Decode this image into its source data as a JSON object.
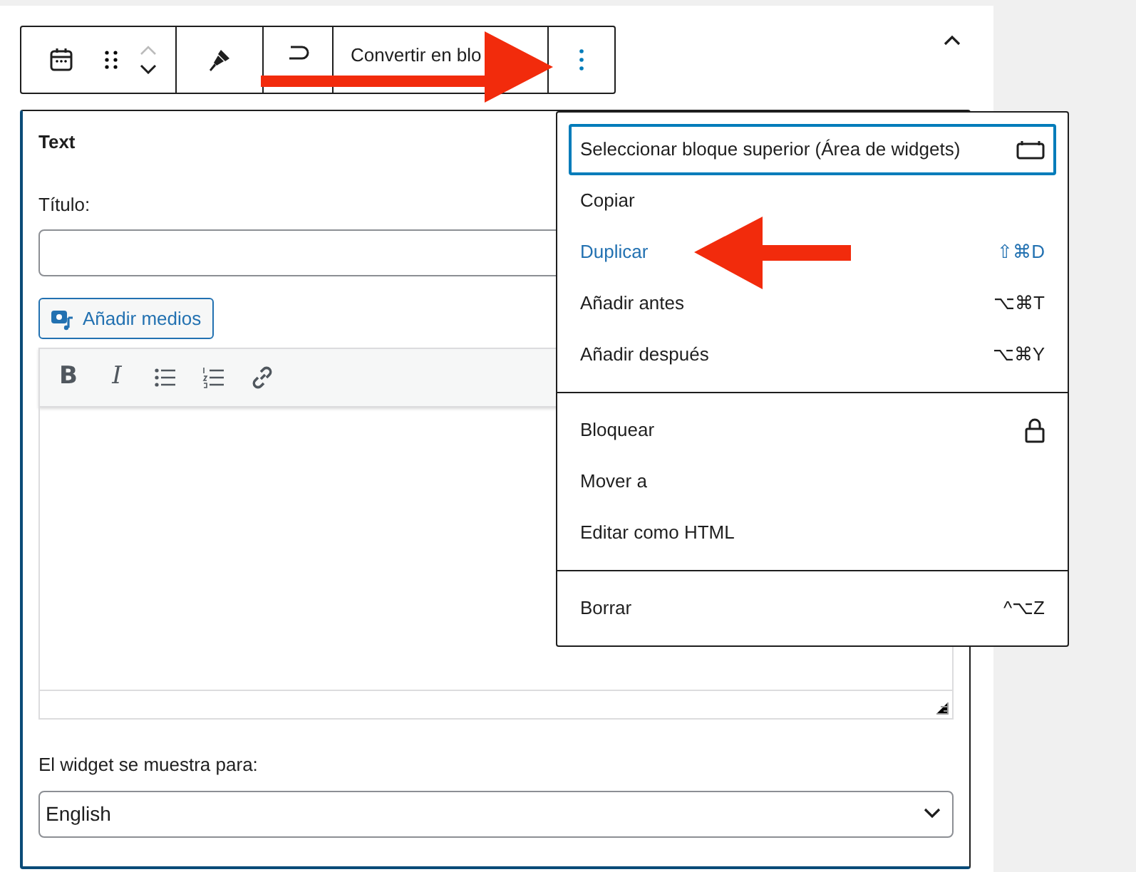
{
  "block_toolbar": {
    "convert_label": "Convertir en blo"
  },
  "widget": {
    "title": "Text",
    "title_field_label": "Título:",
    "add_media": "Añadir medios",
    "format_buttons": [
      "B",
      "I"
    ],
    "display_label": "El widget se muestra para:",
    "language": "English"
  },
  "menu": {
    "groups": [
      [
        {
          "label": "Seleccionar bloque superior (Área de widgets)",
          "kind": "parent",
          "focused": true,
          "hovered": false
        },
        {
          "label": "Copiar",
          "kind": "plain",
          "focused": false,
          "hovered": false
        },
        {
          "label": "Duplicar",
          "kind": "shortcut",
          "shortcut": "⇧⌘D",
          "focused": false,
          "hovered": true
        },
        {
          "label": "Añadir antes",
          "kind": "shortcut",
          "shortcut": "⌥⌘T",
          "focused": false,
          "hovered": false
        },
        {
          "label": "Añadir después",
          "kind": "shortcut",
          "shortcut": "⌥⌘Y",
          "focused": false,
          "hovered": false
        }
      ],
      [
        {
          "label": "Bloquear",
          "kind": "lock",
          "focused": false,
          "hovered": false
        },
        {
          "label": "Mover a",
          "kind": "plain",
          "focused": false,
          "hovered": false
        },
        {
          "label": "Editar como HTML",
          "kind": "plain",
          "focused": false,
          "hovered": false
        }
      ],
      [
        {
          "label": "Borrar",
          "kind": "shortcut",
          "shortcut": "^⌥Z",
          "focused": false,
          "hovered": false
        }
      ]
    ]
  }
}
